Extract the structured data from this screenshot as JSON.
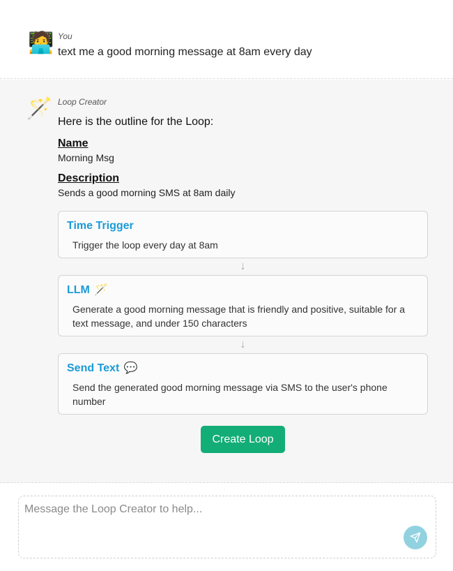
{
  "user_message": {
    "avatar_icon": "person-at-laptop-icon",
    "avatar_glyph": "🧑‍💻",
    "author": "You",
    "text": "text me a good morning message at 8am every day"
  },
  "bot_message": {
    "avatar_icon": "magic-wand-icon",
    "avatar_glyph": "🪄",
    "author": "Loop Creator",
    "intro": "Here is the outline for the Loop:",
    "name_label": "Name",
    "name_value": "Morning Msg",
    "description_label": "Description",
    "description_value": "Sends a good morning SMS at 8am daily",
    "steps": [
      {
        "title": "Time Trigger",
        "emoji": "",
        "description": "Trigger the loop every day at 8am"
      },
      {
        "title": "LLM",
        "emoji": "🪄",
        "description": "Generate a good morning message that is friendly and positive, suitable for a text message, and under 150 characters"
      },
      {
        "title": "Send Text",
        "emoji": "💬",
        "description": "Send the generated good morning message via SMS to the user's phone number"
      }
    ],
    "arrow_glyph": "↓",
    "create_button": "Create Loop"
  },
  "composer": {
    "placeholder": "Message the Loop Creator to help...",
    "send_icon": "send-icon"
  },
  "colors": {
    "accent_blue": "#1a9bd7",
    "button_green": "#13ad78",
    "send_button": "#92d2e0"
  }
}
